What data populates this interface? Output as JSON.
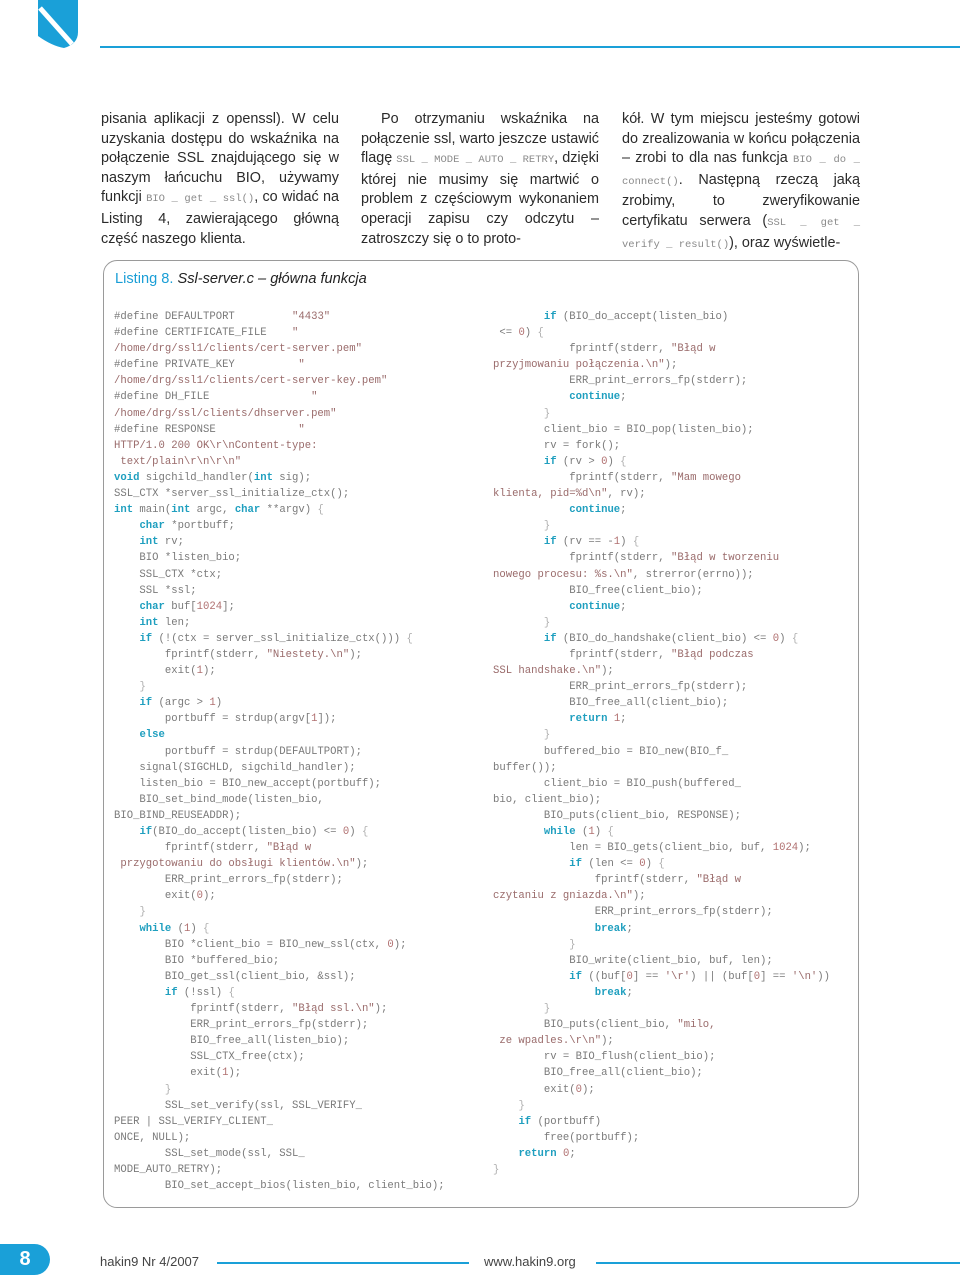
{
  "header": {
    "logo_icon": "shield-icon",
    "accent_color": "#1aa0d8"
  },
  "columns": {
    "col1": {
      "t1": "pisania aplikacji z openssl). W celu uzyskania dostępu do wskaźnika na połączenie SSL znajdującego się w naszym łańcuchu BIO, używamy funkcji ",
      "code1": "BIO _ get _ ssl()",
      "t2": ", co widać na Listing 4, zawierającego główną część naszego klienta."
    },
    "col2": {
      "t1": "Po otrzymaniu wskaźnika na połączenie ssl, warto jeszcze ustawić flagę ",
      "code1": "SSL _ MODE _ AUTO _ RETRY",
      "t2": ", dzięki której nie musimy się martwić o problem z częściowym wykonaniem operacji zapisu czy odczytu – zatroszczy się o to proto-"
    },
    "col3": {
      "t1": "kół. W tym miejscu jesteśmy gotowi do zrealizowania w końcu połączenia – zrobi to dla nas funkcja ",
      "code1": "BIO _ do _ connect()",
      "t2": ". Następną rzeczą jaką zrobimy, to zweryfikowanie certyfikatu serwera (",
      "code2": "SSL _ get _ verify _ result()",
      "t3": "), oraz wyświetle-"
    }
  },
  "listing": {
    "label": "Listing 8.",
    "title": " Ssl-server.c – główna funkcja",
    "left_lines": [
      [
        [
          "p",
          "#define DEFAULTPORT         "
        ],
        [
          "s",
          "\"4433\""
        ]
      ],
      [
        [
          "p",
          "#define CERTIFICATE_FILE    "
        ],
        [
          "s",
          "\""
        ]
      ],
      [
        [
          "s",
          "/home/drg/ssl1/clients/cert-server.pem\""
        ]
      ],
      [
        [
          "p",
          "#define PRIVATE_KEY          "
        ],
        [
          "s",
          "\""
        ]
      ],
      [
        [
          "s",
          "/home/drg/ssl1/clients/cert-server-key.pem\""
        ]
      ],
      [
        [
          "p",
          "#define DH_FILE                "
        ],
        [
          "s",
          "\""
        ]
      ],
      [
        [
          "s",
          "/home/drg/ssl/clients/dhserver.pem\""
        ]
      ],
      [
        [
          "p",
          "#define RESPONSE             "
        ],
        [
          "s",
          "\""
        ]
      ],
      [
        [
          "s",
          "HTTP/1.0 200 OK\\r\\nContent-type:"
        ]
      ],
      [
        [
          "s",
          " text/plain\\r\\n\\r\\n\""
        ]
      ],
      [
        [
          "k",
          "void"
        ],
        [
          "p",
          " sigchild_handler("
        ],
        [
          "k",
          "int"
        ],
        [
          "p",
          " sig);"
        ]
      ],
      [
        [
          "p",
          "SSL_CTX *server_ssl_initialize_ctx();"
        ]
      ],
      [
        [
          "k",
          "int"
        ],
        [
          "p",
          " main("
        ],
        [
          "k",
          "int"
        ],
        [
          "p",
          " argc, "
        ],
        [
          "k",
          "char"
        ],
        [
          "p",
          " **argv) "
        ],
        [
          "b",
          "{"
        ]
      ],
      [
        [
          "p",
          "    "
        ],
        [
          "k",
          "char"
        ],
        [
          "p",
          " *portbuff;"
        ]
      ],
      [
        [
          "p",
          "    "
        ],
        [
          "k",
          "int"
        ],
        [
          "p",
          " rv;"
        ]
      ],
      [
        [
          "p",
          "    BIO *listen_bio;"
        ]
      ],
      [
        [
          "p",
          "    SSL_CTX *ctx;"
        ]
      ],
      [
        [
          "p",
          "    SSL *ssl;"
        ]
      ],
      [
        [
          "p",
          "    "
        ],
        [
          "k",
          "char"
        ],
        [
          "p",
          " buf["
        ],
        [
          "n",
          "1024"
        ],
        [
          "p",
          "];"
        ]
      ],
      [
        [
          "p",
          "    "
        ],
        [
          "k",
          "int"
        ],
        [
          "p",
          " len;"
        ]
      ],
      [
        [
          "p",
          "    "
        ],
        [
          "k",
          "if"
        ],
        [
          "p",
          " (!(ctx = server_ssl_initialize_ctx())) "
        ],
        [
          "b",
          "{"
        ]
      ],
      [
        [
          "p",
          "        fprintf(stderr, "
        ],
        [
          "s",
          "\"Niestety.\\n\""
        ],
        [
          "p",
          ");"
        ]
      ],
      [
        [
          "p",
          "        exit("
        ],
        [
          "n",
          "1"
        ],
        [
          "p",
          ");"
        ]
      ],
      [
        [
          "p",
          "    "
        ],
        [
          "b",
          "}"
        ]
      ],
      [
        [
          "p",
          "    "
        ],
        [
          "k",
          "if"
        ],
        [
          "p",
          " (argc > "
        ],
        [
          "n",
          "1"
        ],
        [
          "p",
          ")"
        ]
      ],
      [
        [
          "p",
          "        portbuff = strdup(argv["
        ],
        [
          "n",
          "1"
        ],
        [
          "p",
          "]);"
        ]
      ],
      [
        [
          "p",
          "    "
        ],
        [
          "k",
          "else"
        ]
      ],
      [
        [
          "p",
          "        portbuff = strdup(DEFAULTPORT);"
        ]
      ],
      [
        [
          "p",
          "    signal(SIGCHLD, sigchild_handler);"
        ]
      ],
      [
        [
          "p",
          "    listen_bio = BIO_new_accept(portbuff);"
        ]
      ],
      [
        [
          "p",
          "    BIO_set_bind_mode(listen_bio,"
        ]
      ],
      [
        [
          "p",
          "BIO_BIND_REUSEADDR);"
        ]
      ],
      [
        [
          "p",
          "    "
        ],
        [
          "k",
          "if"
        ],
        [
          "p",
          "(BIO_do_accept(listen_bio) <= "
        ],
        [
          "n",
          "0"
        ],
        [
          "p",
          ") "
        ],
        [
          "b",
          "{"
        ]
      ],
      [
        [
          "p",
          "        fprintf(stderr, "
        ],
        [
          "s",
          "\"Błąd w"
        ]
      ],
      [
        [
          "s",
          " przygotowaniu do obsługi klientów.\\n\""
        ],
        [
          "p",
          ");"
        ]
      ],
      [
        [
          "p",
          "        ERR_print_errors_fp(stderr);"
        ]
      ],
      [
        [
          "p",
          "        exit("
        ],
        [
          "n",
          "0"
        ],
        [
          "p",
          ");"
        ]
      ],
      [
        [
          "p",
          "    "
        ],
        [
          "b",
          "}"
        ]
      ],
      [
        [
          "p",
          "    "
        ],
        [
          "k",
          "while"
        ],
        [
          "p",
          " ("
        ],
        [
          "n",
          "1"
        ],
        [
          "p",
          ") "
        ],
        [
          "b",
          "{"
        ]
      ],
      [
        [
          "p",
          "        BIO *client_bio = BIO_new_ssl(ctx, "
        ],
        [
          "n",
          "0"
        ],
        [
          "p",
          ");"
        ]
      ],
      [
        [
          "p",
          "        BIO *buffered_bio;"
        ]
      ],
      [
        [
          "p",
          "        BIO_get_ssl(client_bio, &ssl);"
        ]
      ],
      [
        [
          "p",
          "        "
        ],
        [
          "k",
          "if"
        ],
        [
          "p",
          " (!ssl) "
        ],
        [
          "b",
          "{"
        ]
      ],
      [
        [
          "p",
          "            fprintf(stderr, "
        ],
        [
          "s",
          "\"Błąd ssl.\\n\""
        ],
        [
          "p",
          ");"
        ]
      ],
      [
        [
          "p",
          "            ERR_print_errors_fp(stderr);"
        ]
      ],
      [
        [
          "p",
          "            BIO_free_all(listen_bio);"
        ]
      ],
      [
        [
          "p",
          "            SSL_CTX_free(ctx);"
        ]
      ],
      [
        [
          "p",
          "            exit("
        ],
        [
          "n",
          "1"
        ],
        [
          "p",
          ");"
        ]
      ],
      [
        [
          "p",
          "        "
        ],
        [
          "b",
          "}"
        ]
      ],
      [
        [
          "p",
          "        SSL_set_verify(ssl, SSL_VERIFY_"
        ]
      ],
      [
        [
          "p",
          "PEER | SSL_VERIFY_CLIENT_"
        ]
      ],
      [
        [
          "p",
          "ONCE, NULL);"
        ]
      ],
      [
        [
          "p",
          "        SSL_set_mode(ssl, SSL_"
        ]
      ],
      [
        [
          "p",
          "MODE_AUTO_RETRY);"
        ]
      ],
      [
        [
          "p",
          "        BIO_set_accept_bios(listen_bio, client_bio);"
        ]
      ]
    ],
    "right_lines": [
      [
        [
          "p",
          "        "
        ],
        [
          "k",
          "if"
        ],
        [
          "p",
          " (BIO_do_accept(listen_bio)"
        ]
      ],
      [
        [
          "p",
          " <= "
        ],
        [
          "n",
          "0"
        ],
        [
          "p",
          ") "
        ],
        [
          "b",
          "{"
        ]
      ],
      [
        [
          "p",
          "            fprintf(stderr, "
        ],
        [
          "s",
          "\"Błąd w"
        ]
      ],
      [
        [
          "s",
          "przyjmowaniu połączenia.\\n\""
        ],
        [
          "p",
          ");"
        ]
      ],
      [
        [
          "p",
          "            ERR_print_errors_fp(stderr);"
        ]
      ],
      [
        [
          "p",
          "            "
        ],
        [
          "k",
          "continue"
        ],
        [
          "p",
          ";"
        ]
      ],
      [
        [
          "p",
          "        "
        ],
        [
          "b",
          "}"
        ]
      ],
      [
        [
          "p",
          "        client_bio = BIO_pop(listen_bio);"
        ]
      ],
      [
        [
          "p",
          "        rv = fork();"
        ]
      ],
      [
        [
          "p",
          "        "
        ],
        [
          "k",
          "if"
        ],
        [
          "p",
          " (rv > "
        ],
        [
          "n",
          "0"
        ],
        [
          "p",
          ") "
        ],
        [
          "b",
          "{"
        ]
      ],
      [
        [
          "p",
          "            fprintf(stderr, "
        ],
        [
          "s",
          "\"Mam mowego"
        ]
      ],
      [
        [
          "s",
          "klienta, pid=%d\\n\""
        ],
        [
          "p",
          ", rv);"
        ]
      ],
      [
        [
          "p",
          "            "
        ],
        [
          "k",
          "continue"
        ],
        [
          "p",
          ";"
        ]
      ],
      [
        [
          "p",
          "        "
        ],
        [
          "b",
          "}"
        ]
      ],
      [
        [
          "p",
          "        "
        ],
        [
          "k",
          "if"
        ],
        [
          "p",
          " (rv == -"
        ],
        [
          "n",
          "1"
        ],
        [
          "p",
          ") "
        ],
        [
          "b",
          "{"
        ]
      ],
      [
        [
          "p",
          "            fprintf(stderr, "
        ],
        [
          "s",
          "\"Błąd w tworzeniu"
        ]
      ],
      [
        [
          "s",
          "nowego procesu: %s.\\n\""
        ],
        [
          "p",
          ", strerror(errno));"
        ]
      ],
      [
        [
          "p",
          "            BIO_free(client_bio);"
        ]
      ],
      [
        [
          "p",
          "            "
        ],
        [
          "k",
          "continue"
        ],
        [
          "p",
          ";"
        ]
      ],
      [
        [
          "p",
          "        "
        ],
        [
          "b",
          "}"
        ]
      ],
      [
        [
          "p",
          "        "
        ],
        [
          "k",
          "if"
        ],
        [
          "p",
          " (BIO_do_handshake(client_bio) <= "
        ],
        [
          "n",
          "0"
        ],
        [
          "p",
          ") "
        ],
        [
          "b",
          "{"
        ]
      ],
      [
        [
          "p",
          "            fprintf(stderr, "
        ],
        [
          "s",
          "\"Błąd podczas"
        ]
      ],
      [
        [
          "s",
          "SSL handshake.\\n\""
        ],
        [
          "p",
          ");"
        ]
      ],
      [
        [
          "p",
          "            ERR_print_errors_fp(stderr);"
        ]
      ],
      [
        [
          "p",
          "            BIO_free_all(client_bio);"
        ]
      ],
      [
        [
          "p",
          "            "
        ],
        [
          "k",
          "return"
        ],
        [
          "p",
          " "
        ],
        [
          "n",
          "1"
        ],
        [
          "p",
          ";"
        ]
      ],
      [
        [
          "p",
          "        "
        ],
        [
          "b",
          "}"
        ]
      ],
      [
        [
          "p",
          "        buffered_bio = BIO_new(BIO_f_"
        ]
      ],
      [
        [
          "p",
          "buffer());"
        ]
      ],
      [
        [
          "p",
          "        client_bio = BIO_push(buffered_"
        ]
      ],
      [
        [
          "p",
          "bio, client_bio);"
        ]
      ],
      [
        [
          "p",
          "        BIO_puts(client_bio, RESPONSE);"
        ]
      ],
      [
        [
          "p",
          "        "
        ],
        [
          "k",
          "while"
        ],
        [
          "p",
          " ("
        ],
        [
          "n",
          "1"
        ],
        [
          "p",
          ") "
        ],
        [
          "b",
          "{"
        ]
      ],
      [
        [
          "p",
          "            len = BIO_gets(client_bio, buf, "
        ],
        [
          "n",
          "1024"
        ],
        [
          "p",
          ");"
        ]
      ],
      [
        [
          "p",
          "            "
        ],
        [
          "k",
          "if"
        ],
        [
          "p",
          " (len <= "
        ],
        [
          "n",
          "0"
        ],
        [
          "p",
          ") "
        ],
        [
          "b",
          "{"
        ]
      ],
      [
        [
          "p",
          "                fprintf(stderr, "
        ],
        [
          "s",
          "\"Błąd w"
        ]
      ],
      [
        [
          "s",
          "czytaniu z gniazda.\\n\""
        ],
        [
          "p",
          ");"
        ]
      ],
      [
        [
          "p",
          "                ERR_print_errors_fp(stderr);"
        ]
      ],
      [
        [
          "p",
          "                "
        ],
        [
          "k",
          "break"
        ],
        [
          "p",
          ";"
        ]
      ],
      [
        [
          "p",
          "            "
        ],
        [
          "b",
          "}"
        ]
      ],
      [
        [
          "p",
          "            BIO_write(client_bio, buf, len);"
        ]
      ],
      [
        [
          "p",
          "            "
        ],
        [
          "k",
          "if"
        ],
        [
          "p",
          " ((buf["
        ],
        [
          "n",
          "0"
        ],
        [
          "p",
          "] == "
        ],
        [
          "s",
          "'\\r'"
        ],
        [
          "p",
          ") || (buf["
        ],
        [
          "n",
          "0"
        ],
        [
          "p",
          "] == "
        ],
        [
          "s",
          "'\\n'"
        ],
        [
          "p",
          "))"
        ]
      ],
      [
        [
          "p",
          "                "
        ],
        [
          "k",
          "break"
        ],
        [
          "p",
          ";"
        ]
      ],
      [
        [
          "p",
          "        "
        ],
        [
          "b",
          "}"
        ]
      ],
      [
        [
          "p",
          "        BIO_puts(client_bio, "
        ],
        [
          "s",
          "\"milo,"
        ]
      ],
      [
        [
          "s",
          " ze wpadles.\\r\\n\""
        ],
        [
          "p",
          ");"
        ]
      ],
      [
        [
          "p",
          "        rv = BIO_flush(client_bio);"
        ]
      ],
      [
        [
          "p",
          "        BIO_free_all(client_bio);"
        ]
      ],
      [
        [
          "p",
          "        exit("
        ],
        [
          "n",
          "0"
        ],
        [
          "p",
          ");"
        ]
      ],
      [
        [
          "p",
          "    "
        ],
        [
          "b",
          "}"
        ]
      ],
      [
        [
          "p",
          "    "
        ],
        [
          "k",
          "if"
        ],
        [
          "p",
          " (portbuff)"
        ]
      ],
      [
        [
          "p",
          "        free(portbuff);"
        ]
      ],
      [
        [
          "p",
          "    "
        ],
        [
          "k",
          "return"
        ],
        [
          "p",
          " "
        ],
        [
          "n",
          "0"
        ],
        [
          "p",
          ";"
        ]
      ],
      [
        [
          "b",
          "}"
        ]
      ]
    ]
  },
  "footer": {
    "page_number": "8",
    "issue": "hakin9 Nr 4/2007",
    "website": "www.hakin9.org"
  }
}
